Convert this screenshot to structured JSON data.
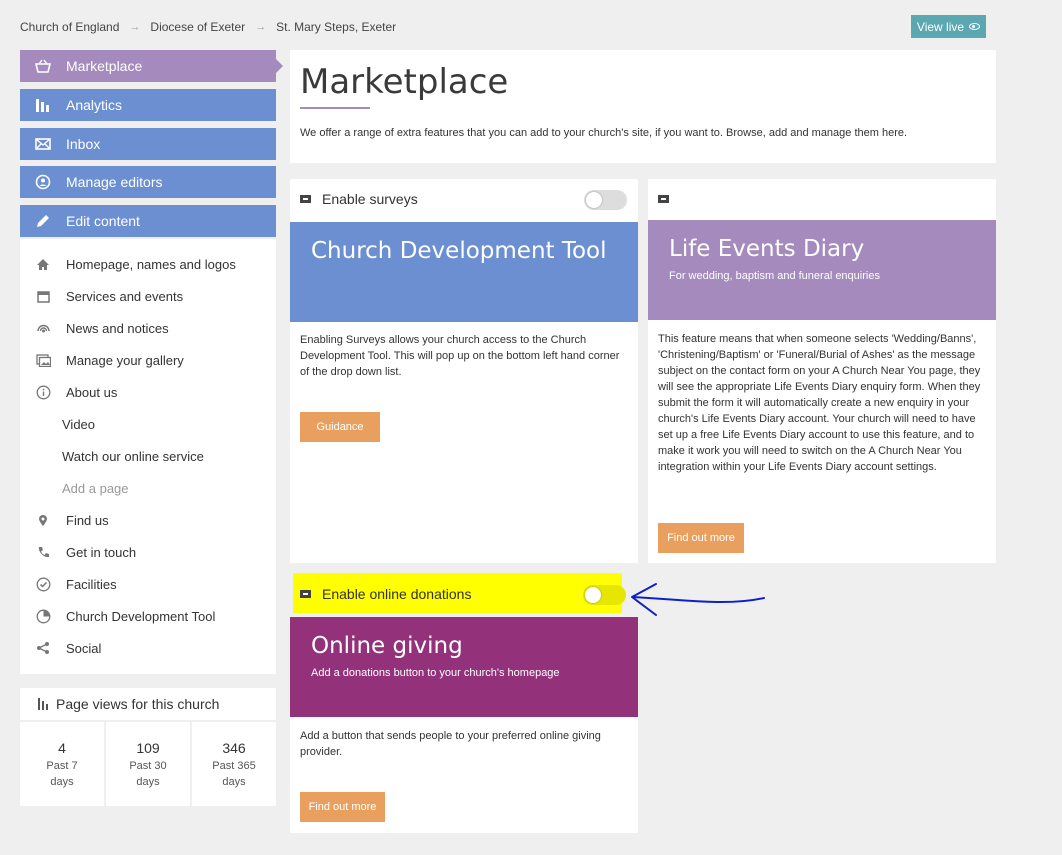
{
  "breadcrumb": [
    "Church of England",
    "Diocese of Exeter",
    "St. Mary Steps, Exeter"
  ],
  "header_button": {
    "label": "View live",
    "icon": "eye-icon"
  },
  "sidebar": {
    "main_nav": [
      {
        "label": "Marketplace",
        "icon": "basket-icon",
        "active": true
      },
      {
        "label": "Analytics",
        "icon": "bar-chart-icon"
      },
      {
        "label": "Inbox",
        "icon": "envelope-icon"
      },
      {
        "label": "Manage editors",
        "icon": "user-circle-icon"
      },
      {
        "label": "Edit content",
        "icon": "pencil-icon"
      }
    ],
    "content_nav": [
      {
        "label": "Homepage, names and logos",
        "icon": "home-icon"
      },
      {
        "label": "Services and events",
        "icon": "calendar-icon"
      },
      {
        "label": "News and notices",
        "icon": "broadcast-icon"
      },
      {
        "label": "Manage your gallery",
        "icon": "gallery-icon"
      },
      {
        "label": "About us",
        "icon": "info-icon"
      },
      {
        "label": "Video"
      },
      {
        "label": "Watch our online service"
      },
      {
        "label": "Add a page"
      },
      {
        "label": "Find us",
        "icon": "map-pin-icon"
      },
      {
        "label": "Get in touch",
        "icon": "phone-icon"
      },
      {
        "label": "Facilities",
        "icon": "check-circle-icon"
      },
      {
        "label": "Church Development Tool",
        "icon": "pie-chart-icon"
      },
      {
        "label": "Social",
        "icon": "share-icon"
      }
    ]
  },
  "page_views": {
    "title": "Page views for this church",
    "stats": [
      {
        "value": "4",
        "label": "Past 7 days"
      },
      {
        "value": "109",
        "label": "Past 30 days"
      },
      {
        "value": "346",
        "label": "Past 365 days"
      }
    ]
  },
  "main": {
    "title": "Marketplace",
    "intro": "We offer a range of extra features that you can add to your church's site, if you want to. Browse, add and manage them here."
  },
  "cards": {
    "surveys": {
      "toggle_label": "Enable surveys",
      "toggle_on": false,
      "title": "Church Development Tool",
      "description": "Enabling Surveys allows your church access to the Church Development Tool. This will pop up on the bottom left hand corner of the drop down list.",
      "button": "Guidance",
      "banner_color": "#6b8fd0"
    },
    "life_events": {
      "title": "Life Events Diary",
      "subtitle": "For wedding, baptism and funeral enquiries",
      "description": "This feature means that when someone selects 'Wedding/Banns', 'Christening/Baptism' or 'Funeral/Burial of Ashes' as the message subject on the contact form on your A Church Near You page, they will see the appropriate Life Events Diary enquiry form. When they submit the form it will automatically create a new enquiry in your church's Life Events Diary account. Your church will need to have set up a free Life Events Diary account to use this feature, and to make it work you will need to switch on the A Church Near You integration within your Life Events Diary account settings.",
      "button": "Find out more",
      "banner_color": "#a58bbd"
    },
    "donations": {
      "toggle_label": "Enable online donations",
      "toggle_on": false,
      "title": "Online giving",
      "subtitle": "Add a donations button to your church's homepage",
      "description": "Add a button that sends people to your preferred online giving provider.",
      "button": "Find out more",
      "banner_color": "#93317a"
    }
  },
  "colors": {
    "nav": "#6b8fd0",
    "nav_active": "#a58bbd",
    "button": "#e9a05f",
    "view_live": "#5ba8b3",
    "highlight": "#ffff00",
    "annotation_arrow": "#1020c8"
  }
}
